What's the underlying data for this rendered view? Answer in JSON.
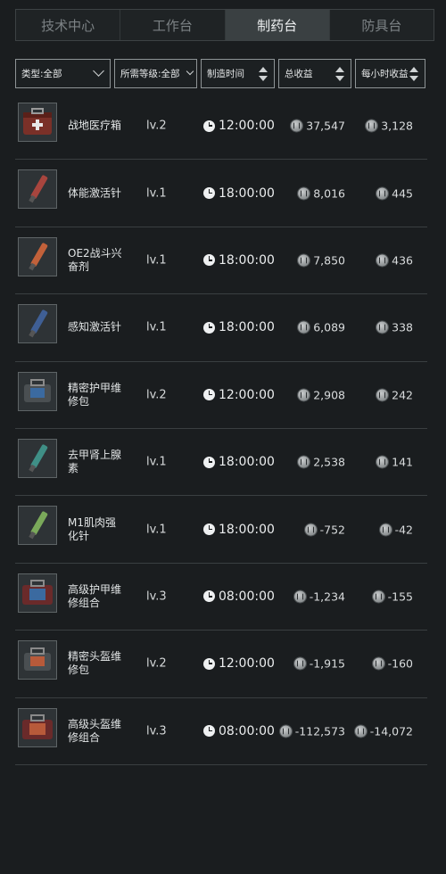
{
  "tabs": [
    {
      "label": "技术中心"
    },
    {
      "label": "工作台"
    },
    {
      "label": "制药台"
    },
    {
      "label": "防具台"
    }
  ],
  "active_tab": 2,
  "filters": {
    "type": "类型:全部",
    "level": "所需等级:全部",
    "craft_time": "制造时间",
    "total_profit": "总收益",
    "hourly_profit": "每小时收益"
  },
  "items": [
    {
      "name": "战地医疗箱",
      "level": "lv.2",
      "time": "12:00:00",
      "total": "37,547",
      "hourly": "3,128",
      "icon": "medkit-icon"
    },
    {
      "name": "体能激活针",
      "level": "lv.1",
      "time": "18:00:00",
      "total": "8,016",
      "hourly": "445",
      "icon": "injector-red-icon"
    },
    {
      "name": "OE2战斗兴奋剂",
      "level": "lv.1",
      "time": "18:00:00",
      "total": "7,850",
      "hourly": "436",
      "icon": "injector-orange-icon"
    },
    {
      "name": "感知激活针",
      "level": "lv.1",
      "time": "18:00:00",
      "total": "6,089",
      "hourly": "338",
      "icon": "injector-blue-icon"
    },
    {
      "name": "精密护甲维修包",
      "level": "lv.2",
      "time": "12:00:00",
      "total": "2,908",
      "hourly": "242",
      "icon": "armor-repair-kit-icon"
    },
    {
      "name": "去甲肾上腺素",
      "level": "lv.1",
      "time": "18:00:00",
      "total": "2,538",
      "hourly": "141",
      "icon": "injector-teal-icon"
    },
    {
      "name": "M1肌肉强化针",
      "level": "lv.1",
      "time": "18:00:00",
      "total": "-752",
      "hourly": "-42",
      "icon": "injector-green-icon"
    },
    {
      "name": "高级护甲维修组合",
      "level": "lv.3",
      "time": "08:00:00",
      "total": "-1,234",
      "hourly": "-155",
      "icon": "advanced-armor-repair-kit-icon"
    },
    {
      "name": "精密头盔维修包",
      "level": "lv.2",
      "time": "12:00:00",
      "total": "-1,915",
      "hourly": "-160",
      "icon": "helmet-repair-kit-icon"
    },
    {
      "name": "高级头盔维修组合",
      "level": "lv.3",
      "time": "08:00:00",
      "total": "-112,573",
      "hourly": "-14,072",
      "icon": "advanced-helmet-repair-kit-icon"
    }
  ],
  "colors": {
    "background": "#1a1d1f",
    "tab_active": "#3a4042",
    "row_divider": "#3a3f41",
    "text": "#e2e5e6"
  }
}
